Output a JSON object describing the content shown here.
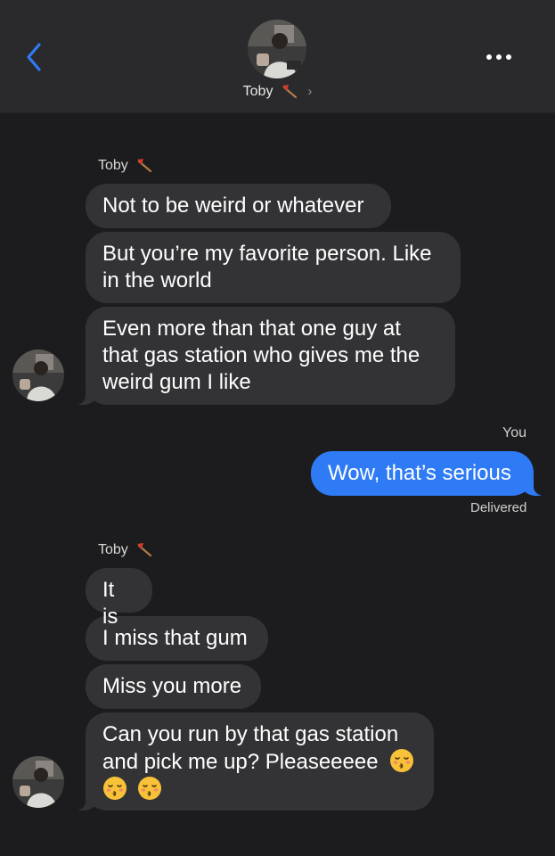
{
  "header": {
    "contact_name": "Toby",
    "contact_emoji": "axe-icon",
    "chevron": "›",
    "back_icon": "chevron-left-icon",
    "more_icon": "more-dots-icon"
  },
  "colors": {
    "background": "#1c1c1e",
    "header": "#2a2a2c",
    "incoming_bubble": "#333336",
    "outgoing_bubble": "#2f7bf5",
    "accent": "#2f7bf5"
  },
  "thread": {
    "group1": {
      "sender": "Toby",
      "messages": [
        "Not to be weird or whatever",
        "But you’re my favorite person. Like",
        "in the world",
        "Even more than that one guy at",
        "that gas station who gives me the",
        "weird gum I like"
      ]
    },
    "outgoing": {
      "sender_label": "You",
      "message": "Wow, that’s serious",
      "status": "Delivered"
    },
    "group2": {
      "sender": "Toby",
      "messages": [
        "It is",
        "I miss that gum",
        "Miss you more",
        "Can you run by that gas station",
        "and pick me up? Pleaseeeee"
      ],
      "emoji": "kissing-face-with-closed-eyes-icon"
    }
  }
}
